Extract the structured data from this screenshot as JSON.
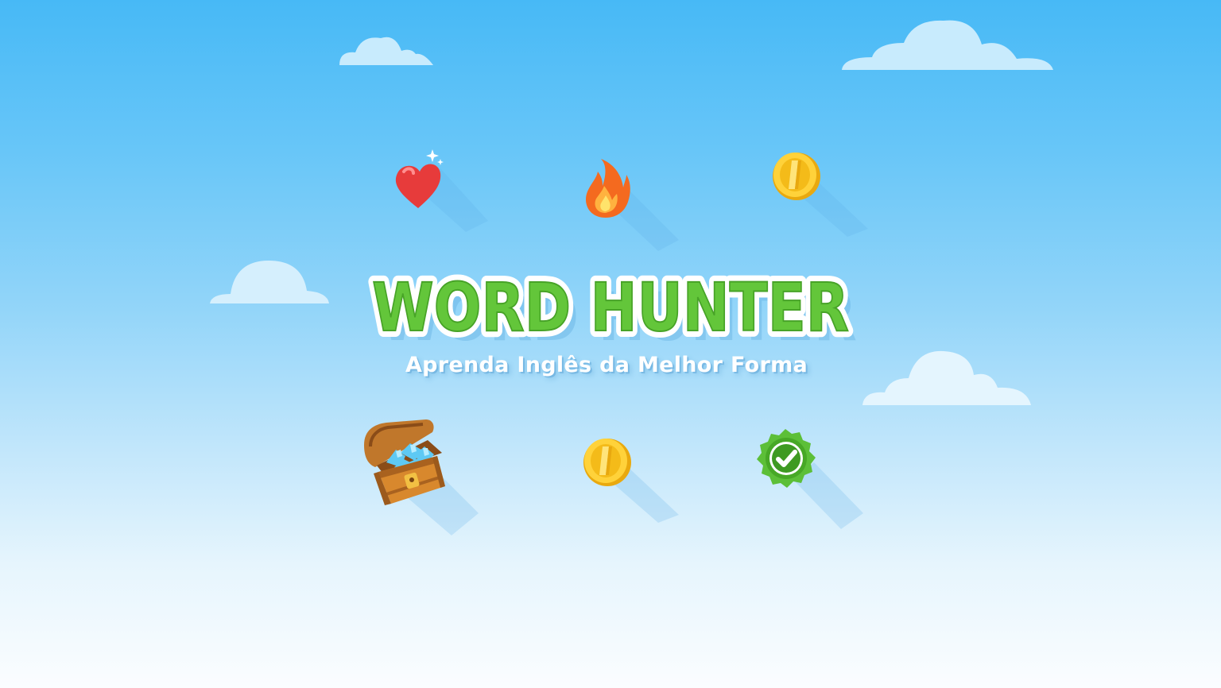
{
  "title": "WORD HUNTER",
  "subtitle": "Aprenda Inglês da Melhor Forma",
  "colors": {
    "sky_top": "#47b9f6",
    "sky_bottom": "#fbfdff",
    "title_green": "#63c63a",
    "title_outline": "#ffffff",
    "cloud": "#c8ebfd"
  },
  "icons": [
    {
      "name": "heart-icon"
    },
    {
      "name": "fire-icon"
    },
    {
      "name": "coin-icon"
    },
    {
      "name": "treasure-chest-icon"
    },
    {
      "name": "coin-icon"
    },
    {
      "name": "check-badge-icon"
    }
  ]
}
